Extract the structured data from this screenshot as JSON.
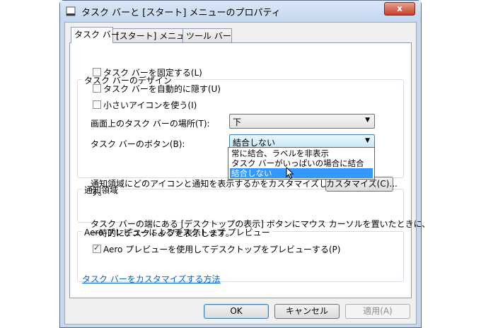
{
  "window": {
    "title": "タスク バーと [スタート] メニューのプロパティ",
    "close_label": "x"
  },
  "tabs": [
    {
      "label": "タスク バー"
    },
    {
      "label": "[スタート] メニュー"
    },
    {
      "label": "ツール バー"
    }
  ],
  "design": {
    "title": "タスク バーのデザイン",
    "lock": {
      "label": "タスク バーを固定する(L)",
      "checked": false
    },
    "autohide": {
      "label": "タスク バーを自動的に隠す(U)",
      "checked": false
    },
    "small_icons": {
      "label": "小さいアイコンを使う(I)",
      "checked": false
    },
    "location_label": "画面上のタスク バーの場所(T):",
    "location_value": "下",
    "buttons_label": "タスク バーのボタン(B):",
    "buttons_value": "結合しない",
    "buttons_options": [
      "常に結合、ラベルを非表示",
      "タスク バーがいっぱいの場合に結合",
      "結合しない"
    ]
  },
  "notify": {
    "title": "通知領域",
    "text_line1": "通知領域にどのアイコンと通知を表示するかをカスタマイズしま",
    "text_line2": "す。",
    "customize_button": "カスタマイズ(C)..."
  },
  "aero": {
    "title": "Aero プレビューによるデスクトップ プレビュー",
    "text_line1": "タスク バーの端にある [デスクトップの表示] ボタンにマウス カーソルを置いたときに、",
    "text_line2": "一時的にデスクトップを表示します。",
    "checkbox": {
      "label": "Aero プレビューを使用してデスクトップをプレビューする(P)",
      "checked": true
    }
  },
  "help_link": "タスク バーをカスタマイズする方法",
  "footer": {
    "ok": "OK",
    "cancel": "キャンセル",
    "apply": "適用(A)"
  }
}
